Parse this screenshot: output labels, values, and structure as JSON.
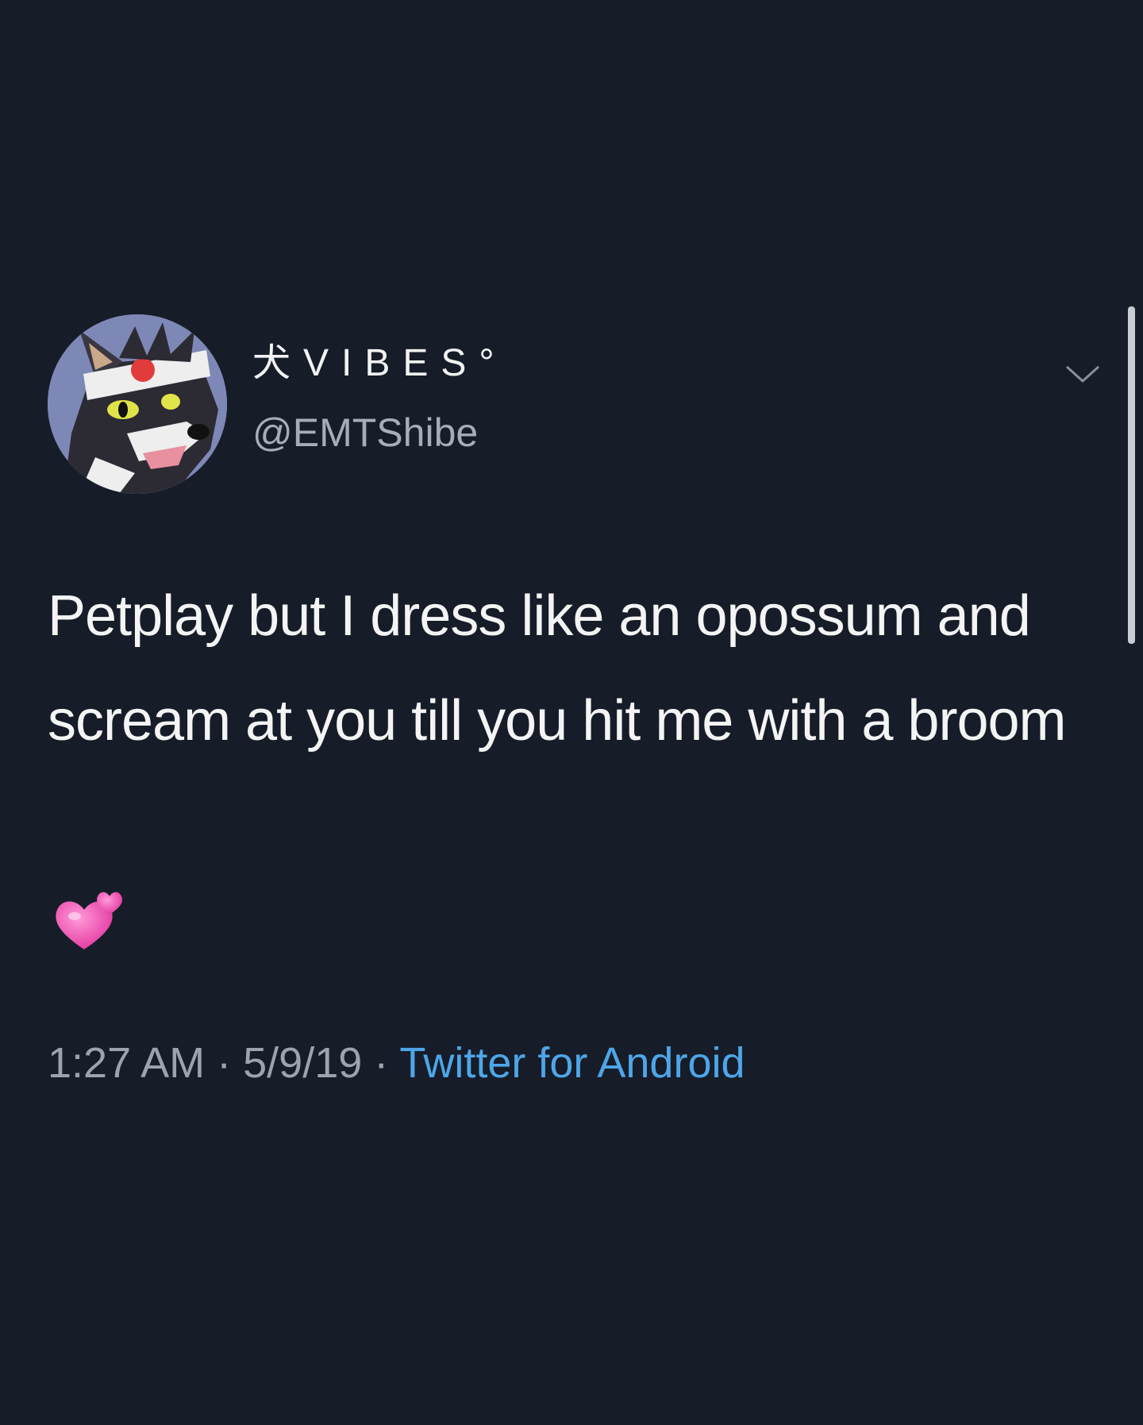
{
  "tweet": {
    "display_name": "犬VIBES°",
    "handle": "@EMTShibe",
    "text": "Petplay but I dress like an opossum and scream at you till you hit me with a broom",
    "emoji": "💞",
    "time": "1:27 AM",
    "separator": "·",
    "date": "5/9/19",
    "source": "Twitter for Android"
  },
  "icons": {
    "menu": "chevron-down-icon",
    "avatar": "shiba-character-avatar",
    "emoji": "revolving-hearts-icon"
  },
  "colors": {
    "background": "#161d29",
    "text_primary": "#f4f4f4",
    "text_secondary": "#9ba3ad",
    "link": "#4ea6e8",
    "emoji_pink": "#f24fb0"
  }
}
